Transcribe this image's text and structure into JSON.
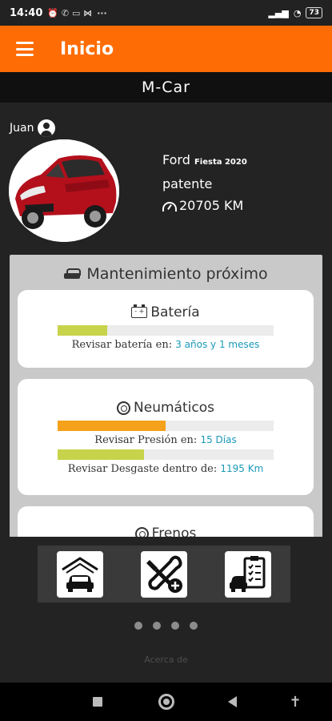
{
  "status_bar": {
    "time": "14:40",
    "notification_glyphs": "⏰ ✆ ▭ ⋈",
    "more": "···",
    "battery": "73"
  },
  "app_bar": {
    "title": "Inicio"
  },
  "subheader": {
    "title": "M-Car"
  },
  "profile": {
    "user_name": "Juan"
  },
  "car": {
    "brand": "Ford",
    "model": "Fiesta 2020",
    "plate_label": "patente",
    "mileage": "20705 KM"
  },
  "maintenance": {
    "title": "Mantenimiento próximo",
    "battery": {
      "title": "Batería",
      "progress": 0.23,
      "label": "Revisar batería en:",
      "value": "3 años y 1 meses"
    },
    "tires": {
      "title": "Neumáticos",
      "pressure_progress": 0.5,
      "pressure_label": "Revisar Presión en:",
      "pressure_value": "15 Días",
      "wear_progress": 0.4,
      "wear_label": "Revisar Desgaste dentro de:",
      "wear_value": "1195 Km"
    },
    "brakes": {
      "title": "Frenos"
    }
  },
  "dock": {
    "garage": "garage-car-icon",
    "tools": "tools-repair-icon",
    "checklist": "car-checklist-icon"
  },
  "pager": {
    "dots": 4
  },
  "footer": {
    "about": "Acerca de"
  },
  "colors": {
    "accent": "#fe6c05",
    "progress_green": "#c7d34a",
    "progress_orange": "#f5a11a",
    "highlight": "#1a9ab8"
  }
}
